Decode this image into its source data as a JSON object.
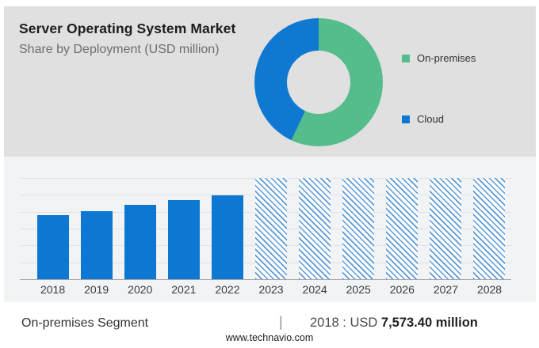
{
  "header": {
    "title": "Server Operating System Market",
    "subtitle": "Share by Deployment (USD million)"
  },
  "legend": {
    "items": [
      {
        "label": "On-premises",
        "color": "#55bd8c"
      },
      {
        "label": "Cloud",
        "color": "#0f79d2"
      }
    ]
  },
  "chart_data": [
    {
      "type": "pie",
      "subtype": "donut",
      "title": "Share by Deployment (USD million)",
      "start_angle_deg": 0,
      "slices": [
        {
          "label": "On-premises",
          "percent": 57,
          "color": "#55bd8c"
        },
        {
          "label": "Cloud",
          "percent": 43,
          "color": "#0f79d2"
        }
      ],
      "legend_position": "right",
      "hole_ratio": 0.5
    },
    {
      "type": "bar",
      "categories": [
        "2018",
        "2019",
        "2020",
        "2021",
        "2022",
        "2023",
        "2024",
        "2025",
        "2026",
        "2027",
        "2028"
      ],
      "values": [
        7573.4,
        8040,
        8720,
        9340,
        9890,
        null,
        null,
        null,
        null,
        null,
        null
      ],
      "values_note": "2018 is labeled USD 7,573.40 million; 2019-2022 estimated from bar heights; 2023-2028 are forecast years drawn as full-height hatched bars with no disclosed values",
      "axis_max": 11900,
      "ylim": [
        0,
        11900
      ],
      "xlabel": "",
      "ylabel": "",
      "grid": true,
      "gridline_count": 7,
      "bar_color": "#0d78d1",
      "hatch_color": "#5a9ad7"
    }
  ],
  "footer": {
    "segment_label": "On-premises Segment",
    "divider": "|",
    "value_prefix": "2018 : USD",
    "value_bold": "7,573.40 million",
    "website": "www.technavio.com"
  }
}
